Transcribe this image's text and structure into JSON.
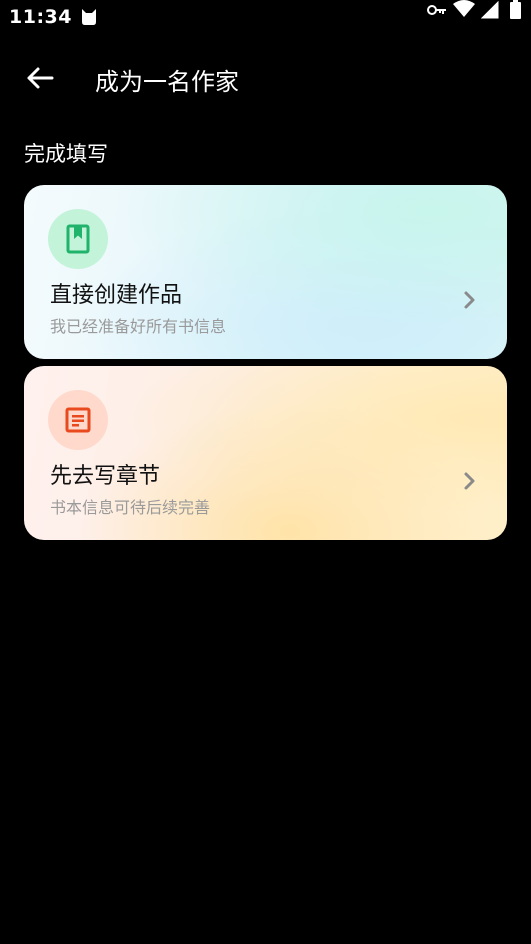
{
  "status_bar": {
    "time": "11:34"
  },
  "app_bar": {
    "title": "成为一名作家"
  },
  "section": {
    "label": "完成填写"
  },
  "options": [
    {
      "title": "直接创建作品",
      "subtitle": "我已经准备好所有书信息",
      "icon": "bookmark-book-icon",
      "accent": "#1fb36b"
    },
    {
      "title": "先去写章节",
      "subtitle": "书本信息可待后续完善",
      "icon": "document-lines-icon",
      "accent": "#e8491d"
    }
  ]
}
